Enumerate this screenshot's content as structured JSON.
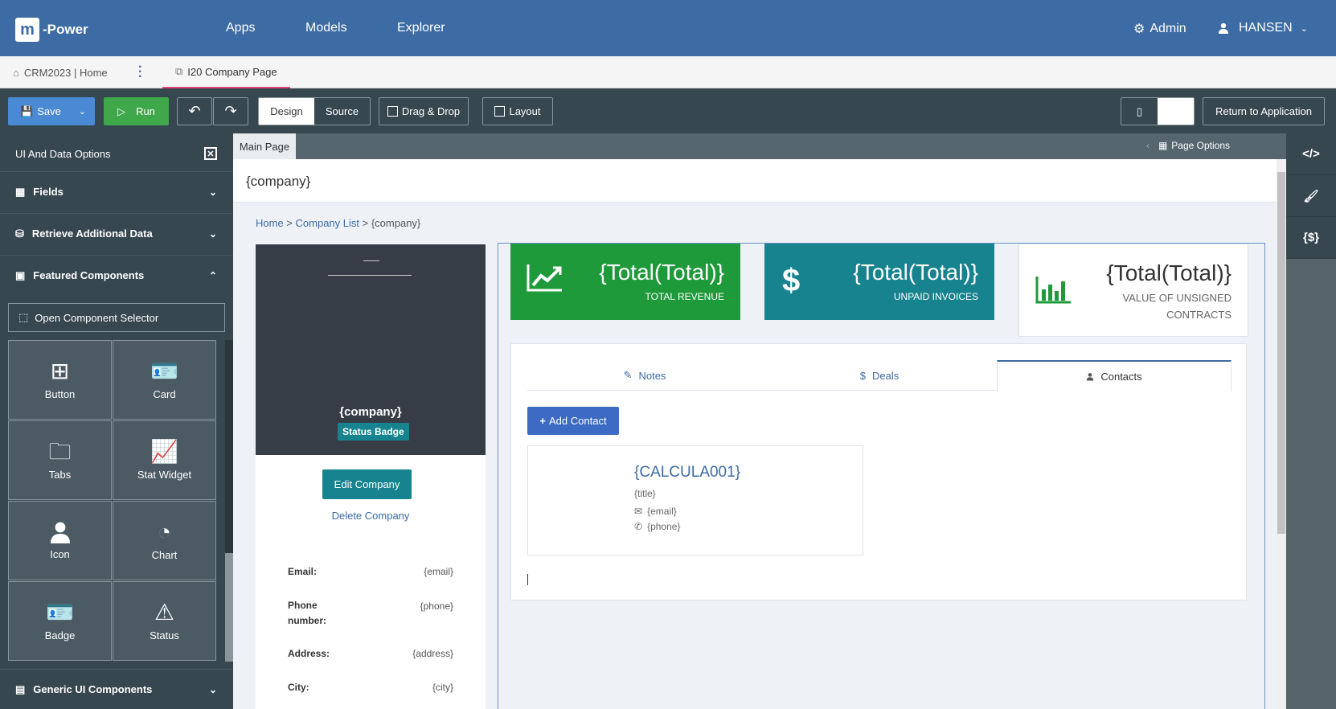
{
  "topnav": {
    "logo_letter": "m",
    "logo_text": "-Power",
    "links": [
      "Apps",
      "Models",
      "Explorer"
    ],
    "admin": "Admin",
    "user": "HANSEN"
  },
  "tabstrip": {
    "home_tab": "CRM2023 | Home",
    "active_tab": "I20 Company Page"
  },
  "toolbar": {
    "save": "Save",
    "run": "Run",
    "design": "Design",
    "source": "Source",
    "drag_drop": "Drag & Drop",
    "layout": "Layout",
    "return": "Return to Application"
  },
  "sidebar": {
    "title": "UI And Data Options",
    "fields": "Fields",
    "retrieve": "Retrieve Additional Data",
    "featured": "Featured Components",
    "open_selector": "Open Component Selector",
    "components": [
      "Button",
      "Card",
      "Tabs",
      "Stat Widget",
      "Icon",
      "Chart",
      "Badge",
      "Status"
    ],
    "generic": "Generic UI Components"
  },
  "canvas": {
    "main_tab": "Main Page",
    "page_options": "Page Options",
    "page_title": "{company}",
    "breadcrumb": {
      "home": "Home",
      "sep1": " > ",
      "list": "Company List",
      "sep2": " > ",
      "current": "{company}"
    }
  },
  "company_card": {
    "name": "{company}",
    "badge": "Status Badge",
    "edit": "Edit Company",
    "delete": "Delete Company",
    "fields": [
      {
        "label": "Email:",
        "value": "{email}"
      },
      {
        "label": "Phone number:",
        "value": "{phone}"
      },
      {
        "label": "Address:",
        "value": "{address}"
      },
      {
        "label": "City:",
        "value": "{city}"
      }
    ]
  },
  "stats": [
    {
      "value": "{Total(Total)}",
      "label": "TOTAL REVENUE",
      "color": "#1f9a3b"
    },
    {
      "value": "{Total(Total)}",
      "label": "UNPAID INVOICES",
      "color": "#17838f"
    },
    {
      "value": "{Total(Total)}",
      "label": "VALUE OF UNSIGNED CONTRACTS",
      "color": "#1f9a3b"
    }
  ],
  "tabs": {
    "notes": "Notes",
    "deals": "Deals",
    "contacts": "Contacts",
    "add_contact": "Add Contact"
  },
  "contact": {
    "name": "{CALCULA001}",
    "title": "{title}",
    "email": "{email}",
    "phone": "{phone}"
  },
  "colors": {
    "nav": "#3d6ba3",
    "toolbar": "#37474f",
    "accent_pink": "#e0457b",
    "teal": "#17838f",
    "green": "#1f9a3b"
  }
}
